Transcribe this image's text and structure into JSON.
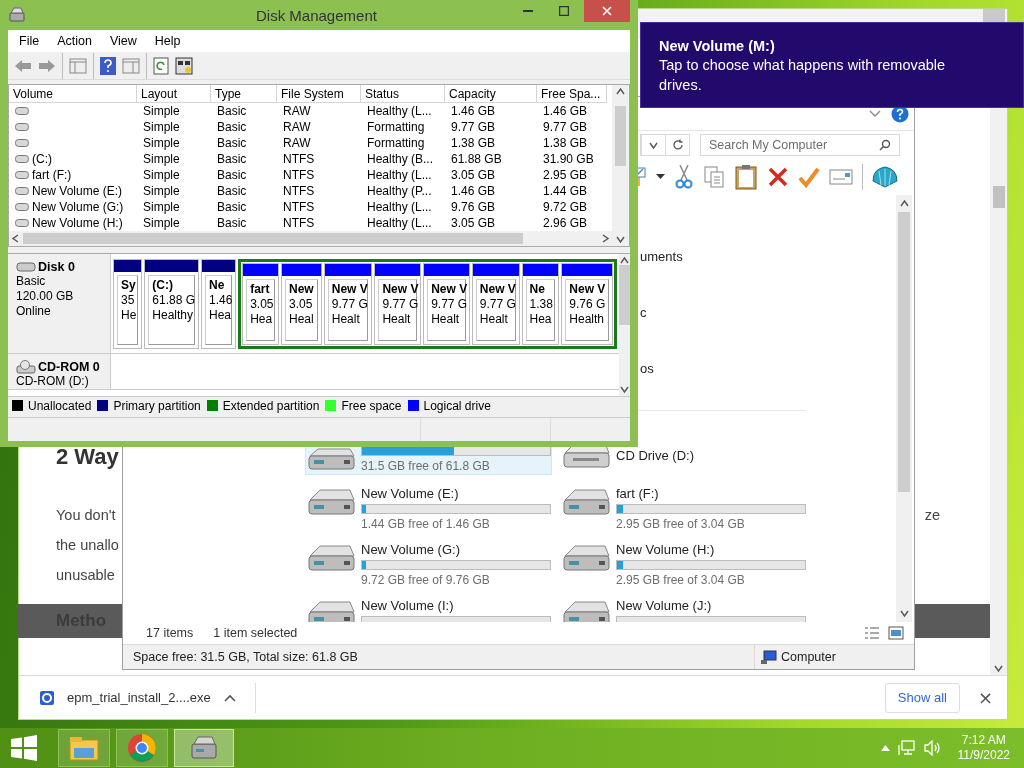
{
  "browser": {
    "heading": "2 Way",
    "lines": [
      {
        "left": "You don't",
        "right": "ze"
      },
      {
        "left": "the unallo"
      },
      {
        "left": "unusable"
      }
    ],
    "section_bar": "Metho",
    "download": {
      "file": "epm_trial_install_2....exe",
      "show_all": "Show all",
      "close": "×"
    }
  },
  "explorer": {
    "search": {
      "placeholder": "Search My Computer"
    },
    "folders": [
      "uments",
      "c",
      "os"
    ],
    "drives": [
      {
        "kind": "hdd",
        "selected": true,
        "level": 0.49,
        "free": "31.5 GB free of 61.8 GB"
      },
      {
        "kind": "hdd",
        "selected": false,
        "name": "New Volume (E:)",
        "level": 0.014,
        "free": "1.44 GB free of 1.46 GB"
      },
      {
        "kind": "hdd",
        "selected": false,
        "name": "New Volume (G:)",
        "level": 0.004,
        "free": "9.72 GB free of 9.76 GB"
      },
      {
        "kind": "hdd",
        "selected": false,
        "name": "New Volume (I:)"
      },
      {
        "kind": "cd",
        "selected": false,
        "name": "CD Drive (D:)"
      },
      {
        "kind": "hdd",
        "selected": false,
        "name": "fart (F:)",
        "level": 0.03,
        "free": "2.95 GB free of 3.04 GB"
      },
      {
        "kind": "hdd",
        "selected": false,
        "name": "New Volume (H:)",
        "level": 0.03,
        "free": "2.95 GB free of 3.04 GB"
      },
      {
        "kind": "hdd",
        "selected": false,
        "name": "New Volume (J:)"
      }
    ],
    "status": {
      "items": "17 items",
      "selected": "1 item selected"
    },
    "details": {
      "space": "Space free: 31.5 GB, Total size: 61.8 GB",
      "location": "Computer"
    }
  },
  "disk_management": {
    "title": "Disk Management",
    "menu": [
      "File",
      "Action",
      "View",
      "Help"
    ],
    "table": {
      "columns": [
        "Volume",
        "Layout",
        "Type",
        "File System",
        "Status",
        "Capacity",
        "Free Spa..."
      ],
      "rows": [
        {
          "layout": "Simple",
          "type": "Basic",
          "file_system": "RAW",
          "status": "Healthy (L...",
          "capacity": "1.46 GB",
          "free_space": "1.46 GB"
        },
        {
          "layout": "Simple",
          "type": "Basic",
          "file_system": "RAW",
          "status": "Formatting",
          "capacity": "9.77 GB",
          "free_space": "9.77 GB"
        },
        {
          "layout": "Simple",
          "type": "Basic",
          "file_system": "RAW",
          "status": "Formatting",
          "capacity": "1.38 GB",
          "free_space": "1.38 GB"
        },
        {
          "volume": "(C:)",
          "layout": "Simple",
          "type": "Basic",
          "file_system": "NTFS",
          "status": "Healthy (B...",
          "capacity": "61.88 GB",
          "free_space": "31.90 GB"
        },
        {
          "volume": "fart (F:)",
          "layout": "Simple",
          "type": "Basic",
          "file_system": "NTFS",
          "status": "Healthy (L...",
          "capacity": "3.05 GB",
          "free_space": "2.95 GB"
        },
        {
          "volume": "New Volume (E:)",
          "layout": "Simple",
          "type": "Basic",
          "file_system": "NTFS",
          "status": "Healthy (P...",
          "capacity": "1.46 GB",
          "free_space": "1.44 GB"
        },
        {
          "volume": "New Volume (G:)",
          "layout": "Simple",
          "type": "Basic",
          "file_system": "NTFS",
          "status": "Healthy (L...",
          "capacity": "9.76 GB",
          "free_space": "9.72 GB"
        },
        {
          "volume": "New Volume (H:)",
          "layout": "Simple",
          "type": "Basic",
          "file_system": "NTFS",
          "status": "Healthy (L...",
          "capacity": "3.05 GB",
          "free_space": "2.96 GB"
        }
      ]
    },
    "disks": [
      {
        "kind": "hdd",
        "name": "Disk 0",
        "lines": [
          "Basic",
          "120.00 GB",
          "Online"
        ],
        "partitions": [
          {
            "kind": "primary",
            "lines": [
              "Sy",
              "35",
              "He"
            ]
          },
          {
            "kind": "primary",
            "lines": [
              "(C:)",
              "61.88 G",
              "Healthy"
            ]
          },
          {
            "kind": "primary",
            "lines": [
              "Ne",
              "1.46",
              "Hea"
            ]
          },
          {
            "kind": "extended",
            "children": [
              {
                "kind": "logical",
                "lines": [
                  "fart",
                  "3.05",
                  "Hea"
                ]
              },
              {
                "kind": "logical",
                "lines": [
                  "New",
                  "3.05",
                  "Heal"
                ]
              },
              {
                "kind": "logical",
                "lines": [
                  "New V",
                  "9.77 G",
                  "Healt"
                ]
              },
              {
                "kind": "logical",
                "lines": [
                  "New V",
                  "9.77 G",
                  "Healt"
                ]
              },
              {
                "kind": "logical",
                "lines": [
                  "New V",
                  "9.77 G",
                  "Healt"
                ]
              },
              {
                "kind": "logical",
                "lines": [
                  "New V",
                  "9.77 G",
                  "Healt"
                ]
              },
              {
                "kind": "logical",
                "lines": [
                  "Ne",
                  "1.38",
                  "Hea"
                ]
              },
              {
                "kind": "logical",
                "lines": [
                  "New V",
                  "9.76 G",
                  "Health"
                ]
              }
            ]
          }
        ]
      },
      {
        "kind": "cdrom",
        "name": "CD-ROM 0",
        "lines": [
          "CD-ROM (D:)"
        ]
      }
    ],
    "legend": [
      {
        "label": "Unallocated",
        "color": "#000000"
      },
      {
        "label": "Primary partition",
        "color": "#000080"
      },
      {
        "label": "Extended partition",
        "color": "#008000"
      },
      {
        "label": "Free space",
        "color": "#33ff33"
      },
      {
        "label": "Logical drive",
        "color": "#0000ff"
      }
    ]
  },
  "toast": {
    "title": "New Volume (M:)",
    "message": "Tap to choose what happens with removable drives."
  },
  "taskbar": {
    "apps": [
      {
        "kind": "files",
        "active": false
      },
      {
        "kind": "browser",
        "active": false
      },
      {
        "kind": "disk",
        "active": true
      }
    ],
    "time": "7:12 AM",
    "date": "11/9/2022"
  }
}
